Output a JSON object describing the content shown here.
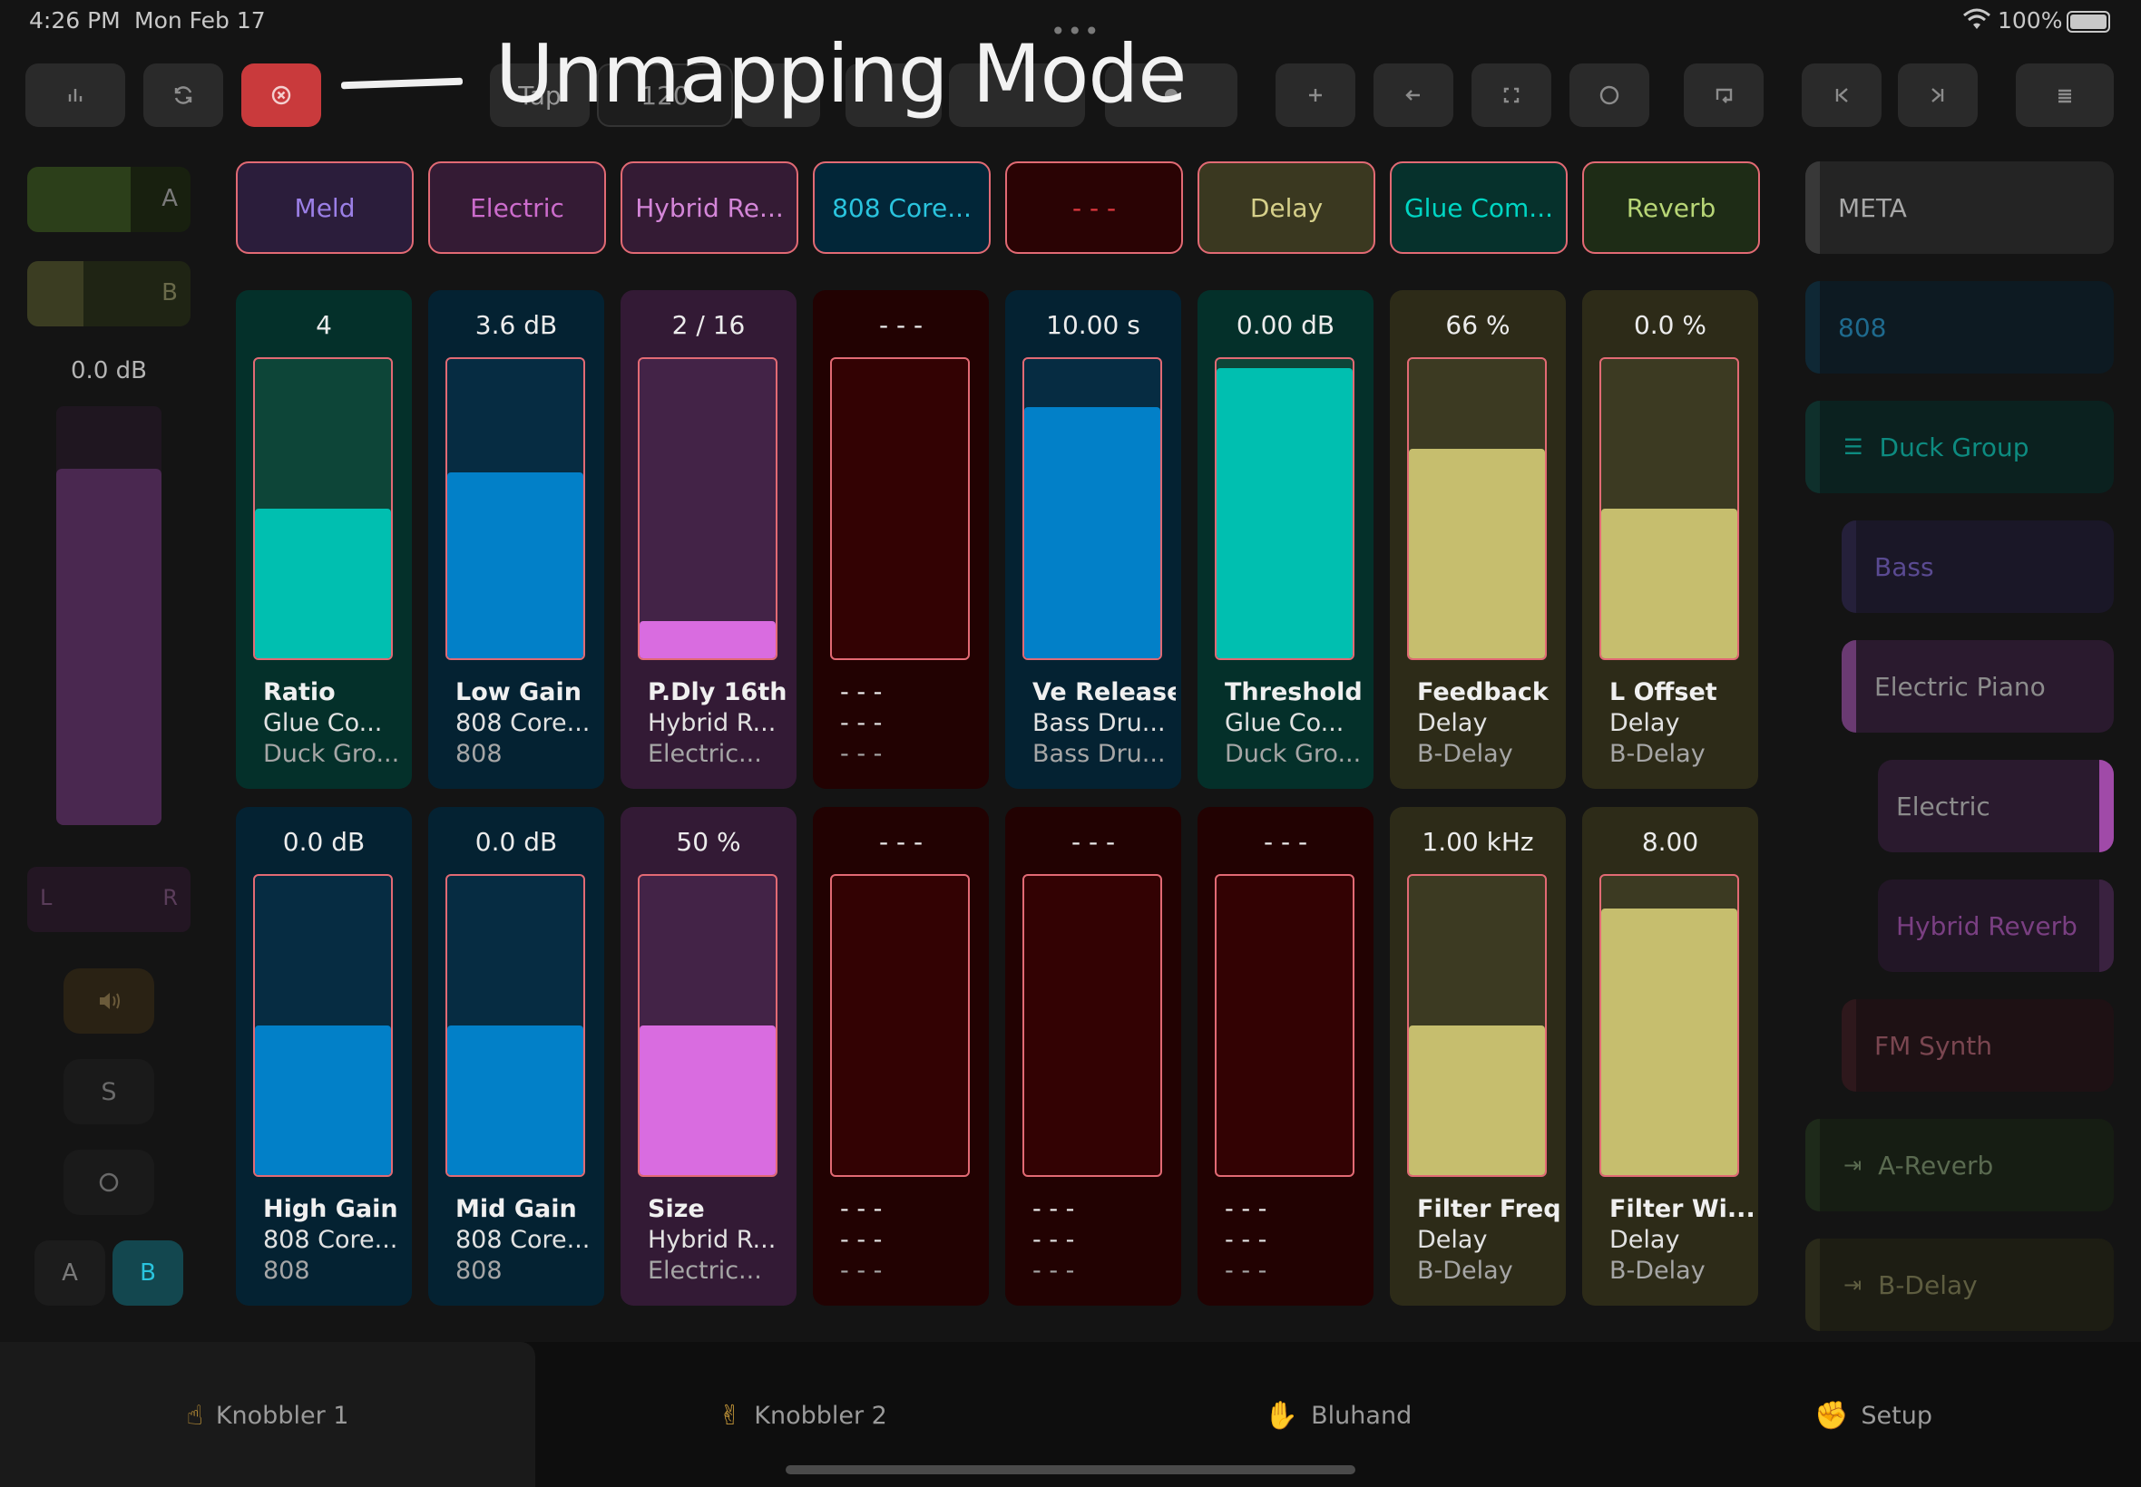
{
  "status_bar": {
    "time": "4:26 PM",
    "date": "Mon Feb 17",
    "battery": "100%"
  },
  "annotation": {
    "text": "Unmapping Mode"
  },
  "toolbar": {
    "obscured_1": "Tap",
    "obscured_2": "120"
  },
  "mixer": {
    "volume_label": "0.0 dB",
    "volume_level": 0.85,
    "pan_left": "L",
    "pan_right": "R",
    "crossfader_a": "A",
    "crossfader_b": "B",
    "solo": "S",
    "ab_a": "A",
    "ab_b": "B"
  },
  "devices": [
    "Meld",
    "Electric",
    "Hybrid Re...",
    "808 Core...",
    "- - -",
    "Delay",
    "Glue Com...",
    "Reverb"
  ],
  "row1": [
    {
      "value": "4",
      "name": "Ratio",
      "device": "Glue Co...",
      "track": "Duck Gro...",
      "level": 0.5
    },
    {
      "value": "3.6 dB",
      "name": "Low Gain",
      "device": "808 Core...",
      "track": "808",
      "level": 0.62
    },
    {
      "value": "2  / 16",
      "name": "P.Dly 16th",
      "device": "Hybrid R...",
      "track": "Electric...",
      "level": 0.125
    },
    {
      "value": "- - -",
      "name": "- - -",
      "device": "- - -",
      "track": "- - -",
      "level": 0
    },
    {
      "value": "10.00 s",
      "name": "Ve Release",
      "device": "Bass Dru...",
      "track": "Bass Dru...",
      "level": 0.84
    },
    {
      "value": "0.00 dB",
      "name": "Threshold",
      "device": "Glue Co...",
      "track": "Duck Gro...",
      "level": 0.97
    },
    {
      "value": "66 %",
      "name": "Feedback",
      "device": "Delay",
      "track": "B-Delay",
      "level": 0.7
    },
    {
      "value": "0.0 %",
      "name": "L Offset",
      "device": "Delay",
      "track": "B-Delay",
      "level": 0.5
    }
  ],
  "row2": [
    {
      "value": "0.0 dB",
      "name": "High Gain",
      "device": "808 Core...",
      "track": "808",
      "level": 0.5
    },
    {
      "value": "0.0 dB",
      "name": "Mid Gain",
      "device": "808 Core...",
      "track": "808",
      "level": 0.5
    },
    {
      "value": "50 %",
      "name": "Size",
      "device": "Hybrid R...",
      "track": "Electric...",
      "level": 0.5
    },
    {
      "value": "- - -",
      "name": "- - -",
      "device": "- - -",
      "track": "- - -",
      "level": 0
    },
    {
      "value": "- - -",
      "name": "- - -",
      "device": "- - -",
      "track": "- - -",
      "level": 0
    },
    {
      "value": "- - -",
      "name": "- - -",
      "device": "- - -",
      "track": "- - -",
      "level": 0
    },
    {
      "value": "1.00 kHz",
      "name": "Filter Freq",
      "device": "Delay",
      "track": "B-Delay",
      "level": 0.5
    },
    {
      "value": "8.00",
      "name": "Filter Wi...",
      "device": "Delay",
      "track": "B-Delay",
      "level": 0.89
    }
  ],
  "tracks": [
    "META",
    "808",
    "Duck Group",
    "Bass",
    "Electric Piano",
    "Electric",
    "Hybrid Reverb",
    "FM Synth",
    "A-Reverb",
    "B-Delay"
  ],
  "tabs": [
    "Knobbler 1",
    "Knobbler 2",
    "Bluhand",
    "Setup"
  ],
  "colors": {
    "accent_red": "#c93a3c",
    "card_border": "#e26a74",
    "teal": "#00bfb0",
    "blue": "#0280c8",
    "pink": "#d96ce0",
    "olive": "#c6be6e",
    "meld": "#9b7fe6",
    "electric": "#cc6ccc",
    "cyan": "#2ac4de",
    "green": "#b8d676"
  }
}
